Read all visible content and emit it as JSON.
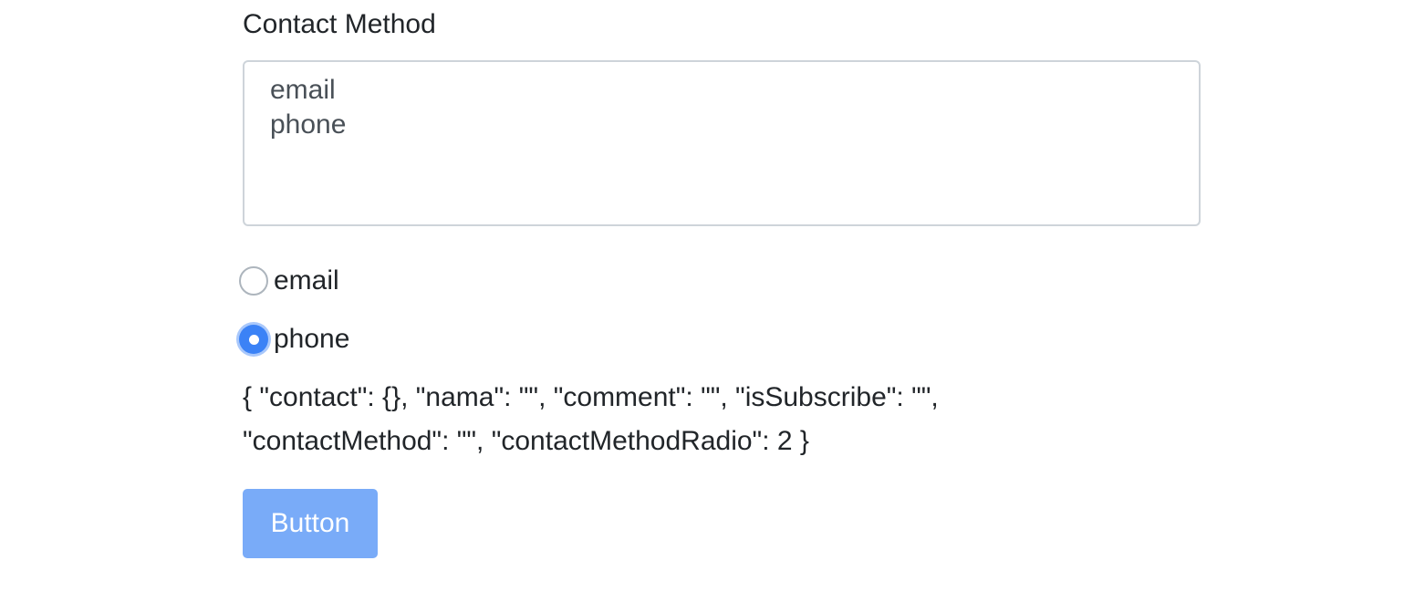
{
  "form": {
    "contact_method_label": "Contact Method",
    "select_options": [
      "email",
      "phone"
    ],
    "radio_options": [
      {
        "label": "email",
        "checked": false
      },
      {
        "label": "phone",
        "checked": true
      }
    ],
    "state_output": "{ \"contact\": {}, \"nama\": \"\", \"comment\": \"\", \"isSubscribe\": \"\", \"contactMethod\": \"\", \"contactMethodRadio\": 2 }",
    "button_label": "Button"
  },
  "colors": {
    "accent": "#3b82f6",
    "button_bg": "#79abf8",
    "text": "#212529",
    "border": "#ced4da"
  }
}
